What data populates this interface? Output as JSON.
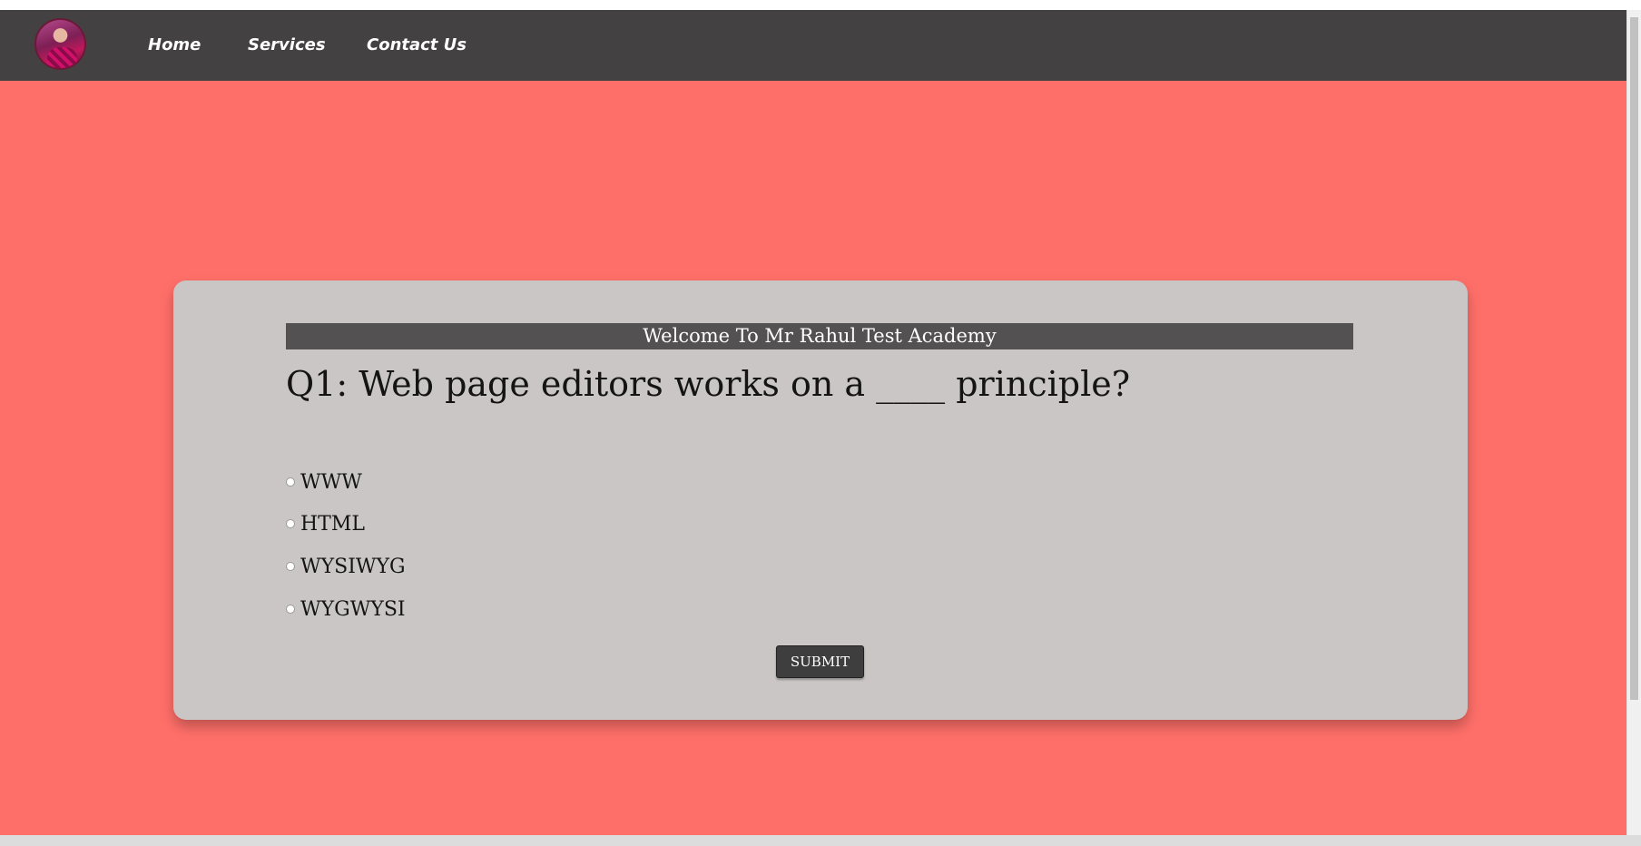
{
  "nav": {
    "links": [
      "Home",
      "Services",
      "Contact Us"
    ]
  },
  "quiz": {
    "welcome": "Welcome To Mr Rahul Test Academy",
    "question": "Q1: Web page editors works on a ____ principle?",
    "options": [
      "WWW",
      "HTML",
      "WYSIWYG",
      "WYGWYSI"
    ],
    "submit_label": "SUBMIT"
  },
  "colors": {
    "page_background": "#ff6f69",
    "navbar": "#434142",
    "card": "#cac6c5",
    "welcome_bar": "#535152",
    "submit_button": "#3e3e3e"
  },
  "icons": {
    "avatar": "profile-photo"
  }
}
